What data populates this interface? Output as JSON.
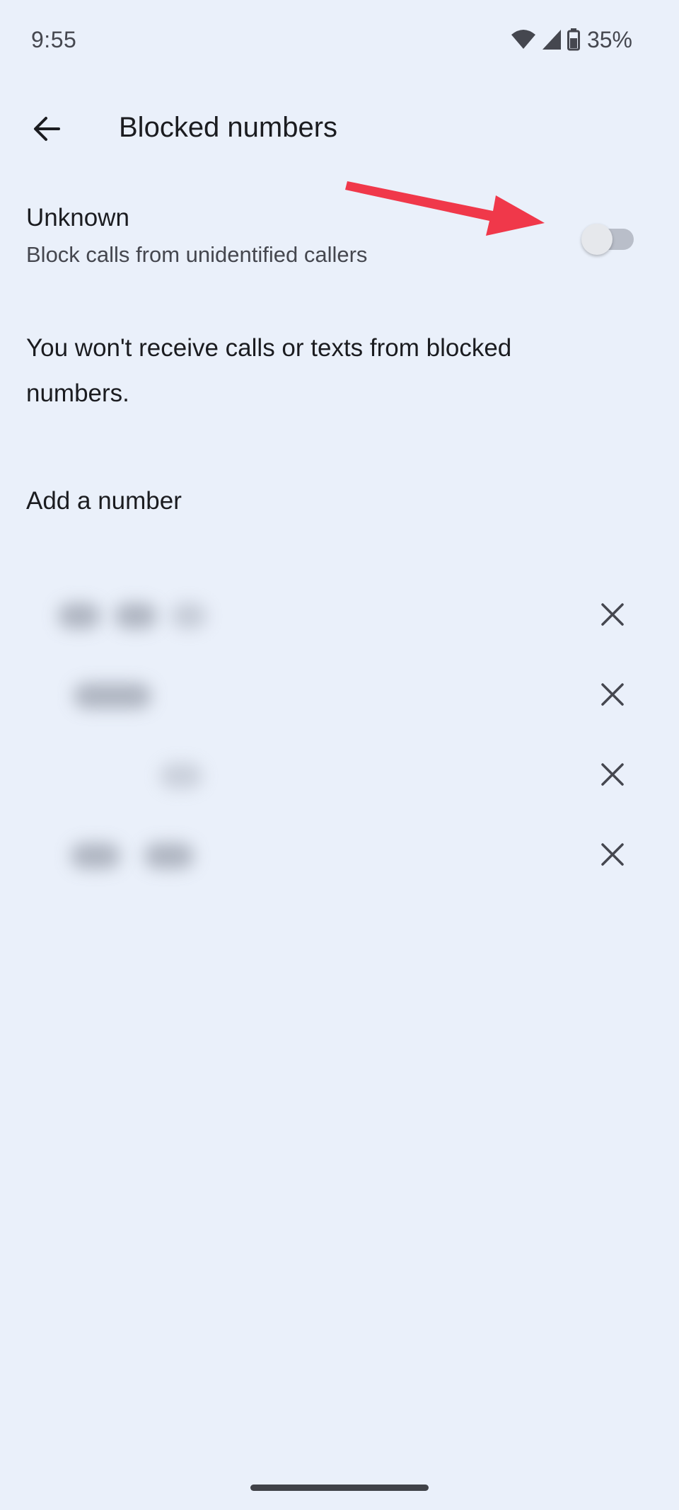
{
  "status_bar": {
    "time": "9:55",
    "battery_percent": "35%",
    "icons": [
      "wifi-icon",
      "cell-signal-icon",
      "battery-icon"
    ]
  },
  "app_bar": {
    "title": "Blocked numbers",
    "back_icon": "arrow-back-icon"
  },
  "unknown_setting": {
    "title": "Unknown",
    "summary": "Block calls from unidentified callers",
    "enabled": false
  },
  "info": {
    "text": "You won't receive calls or texts from blocked numbers."
  },
  "add_number": {
    "label": "Add a number"
  },
  "blocked_numbers": {
    "count": 4,
    "remove_icon": "close-icon",
    "items_obscured": true
  },
  "colors": {
    "background": "#eaf0fa",
    "annotation_arrow": "#f0384a",
    "text_primary": "#1b1c20",
    "text_secondary": "#45474f"
  }
}
